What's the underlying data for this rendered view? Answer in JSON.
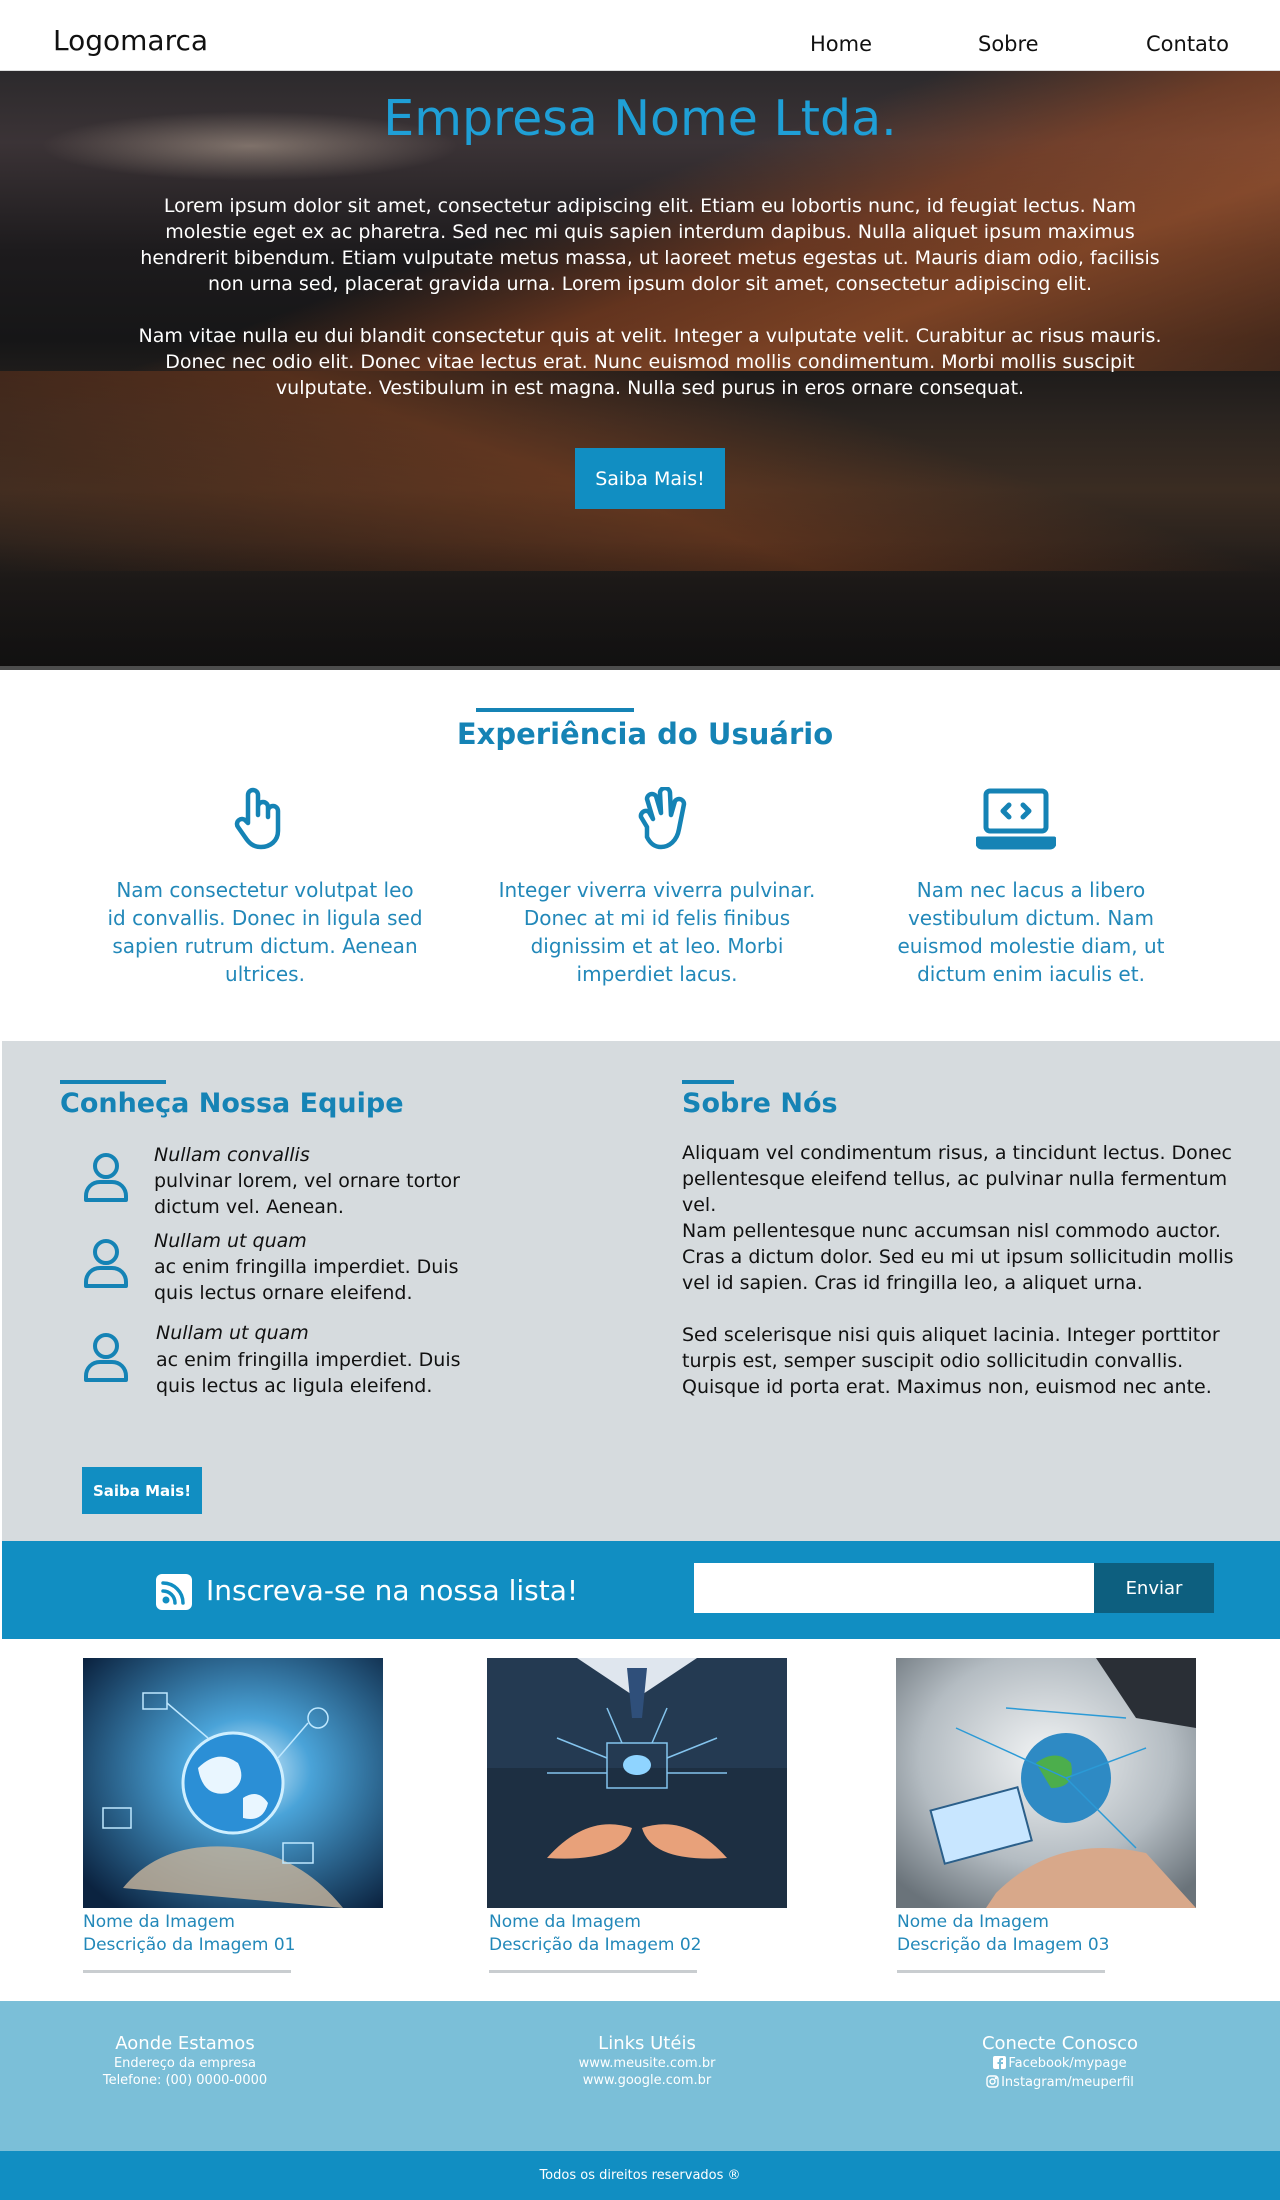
{
  "navbar": {
    "logo": "Logomarca",
    "links": [
      "Home",
      "Sobre",
      "Contato"
    ]
  },
  "hero": {
    "title": "Empresa Nome Ltda.",
    "paragraph1": "Lorem ipsum dolor sit amet, consectetur adipiscing elit. Etiam eu lobortis nunc, id feugiat lectus. Nam molestie eget ex ac pharetra. Sed nec mi quis sapien interdum dapibus. Nulla aliquet ipsum maximus hendrerit bibendum. Etiam vulputate metus massa, ut laoreet metus egestas ut. Mauris diam odio, facilisis non urna sed, placerat gravida urna. Lorem ipsum dolor sit amet, consectetur adipiscing elit.",
    "paragraph2": "Nam vitae nulla eu dui blandit consectetur quis at velit. Integer a vulputate velit. Curabitur ac risus mauris. Donec nec odio elit. Donec vitae lectus erat. Nunc euismod mollis condimentum. Morbi mollis suscipit vulputate. Vestibulum in est magna. Nulla sed purus in eros ornare consequat.",
    "button": "Saiba Mais!"
  },
  "experience": {
    "title": "Experiência do Usuário",
    "features": [
      {
        "icon": "hand-pointer-icon",
        "text": "Nam consectetur volutpat leo id convallis. Donec in ligula sed sapien rutrum dictum. Aenean ultrices."
      },
      {
        "icon": "hand-spock-icon",
        "text": "Integer viverra viverra pulvinar. Donec at mi id felis finibus dignissim et at leo. Morbi imperdiet lacus."
      },
      {
        "icon": "laptop-code-icon",
        "text": "Nam nec lacus a libero vestibulum dictum. Nam euismod molestie diam, ut dictum enim iaculis et."
      }
    ]
  },
  "team": {
    "title": "Conheça Nossa Equipe",
    "members": [
      {
        "name": "Nullam convallis",
        "desc": "pulvinar lorem, vel ornare tortor dictum vel. Aenean."
      },
      {
        "name": "Nullam ut quam",
        "desc": "ac enim fringilla imperdiet. Duis quis lectus ornare eleifend."
      },
      {
        "name": "Nullam ut quam",
        "desc": "ac enim fringilla imperdiet. Duis quis lectus ac ligula eleifend."
      }
    ],
    "button": "Saiba Mais!"
  },
  "about": {
    "title": "Sobre Nós",
    "paragraphs": [
      "Aliquam vel condimentum risus, a tincidunt lectus. Donec pellentesque eleifend tellus, ac pulvinar nulla fermentum vel.",
      "Nam pellentesque nunc accumsan nisl commodo auctor. Cras a dictum dolor. Sed eu mi ut ipsum sollicitudin mollis vel id sapien. Cras id fringilla leo, a aliquet urna.",
      "Sed scelerisque nisi quis aliquet lacinia. Integer porttitor turpis est, semper suscipit odio sollicitudin convallis. Quisque id porta erat. Maximus non, euismod nec ante."
    ]
  },
  "newsletter": {
    "icon": "rss-icon",
    "text": "Inscreva-se na nossa lista!",
    "input_value": "",
    "button": "Enviar"
  },
  "gallery": [
    {
      "name": "Nome da Imagem",
      "desc": "Descrição da Imagem 01"
    },
    {
      "name": "Nome da Imagem",
      "desc": "Descrição da Imagem 02"
    },
    {
      "name": "Nome da Imagem",
      "desc": "Descrição da Imagem 03"
    }
  ],
  "footer": {
    "location": {
      "title": "Aonde Estamos",
      "lines": [
        "Endereço da empresa",
        "Telefone: (00) 0000-0000"
      ]
    },
    "links": {
      "title": "Links Utéis",
      "lines": [
        "www.meusite.com.br",
        "www.google.com.br"
      ]
    },
    "social": {
      "title": "Conecte Conosco",
      "facebook": "Facebook/mypage",
      "instagram": "Instagram/meuperfil"
    },
    "copyright": "Todos os direitos reservados ®"
  },
  "colors": {
    "accent": "#1583b5",
    "button": "#118ec2",
    "gray_section": "#d6dbde",
    "footer": "#7bbfd8"
  }
}
